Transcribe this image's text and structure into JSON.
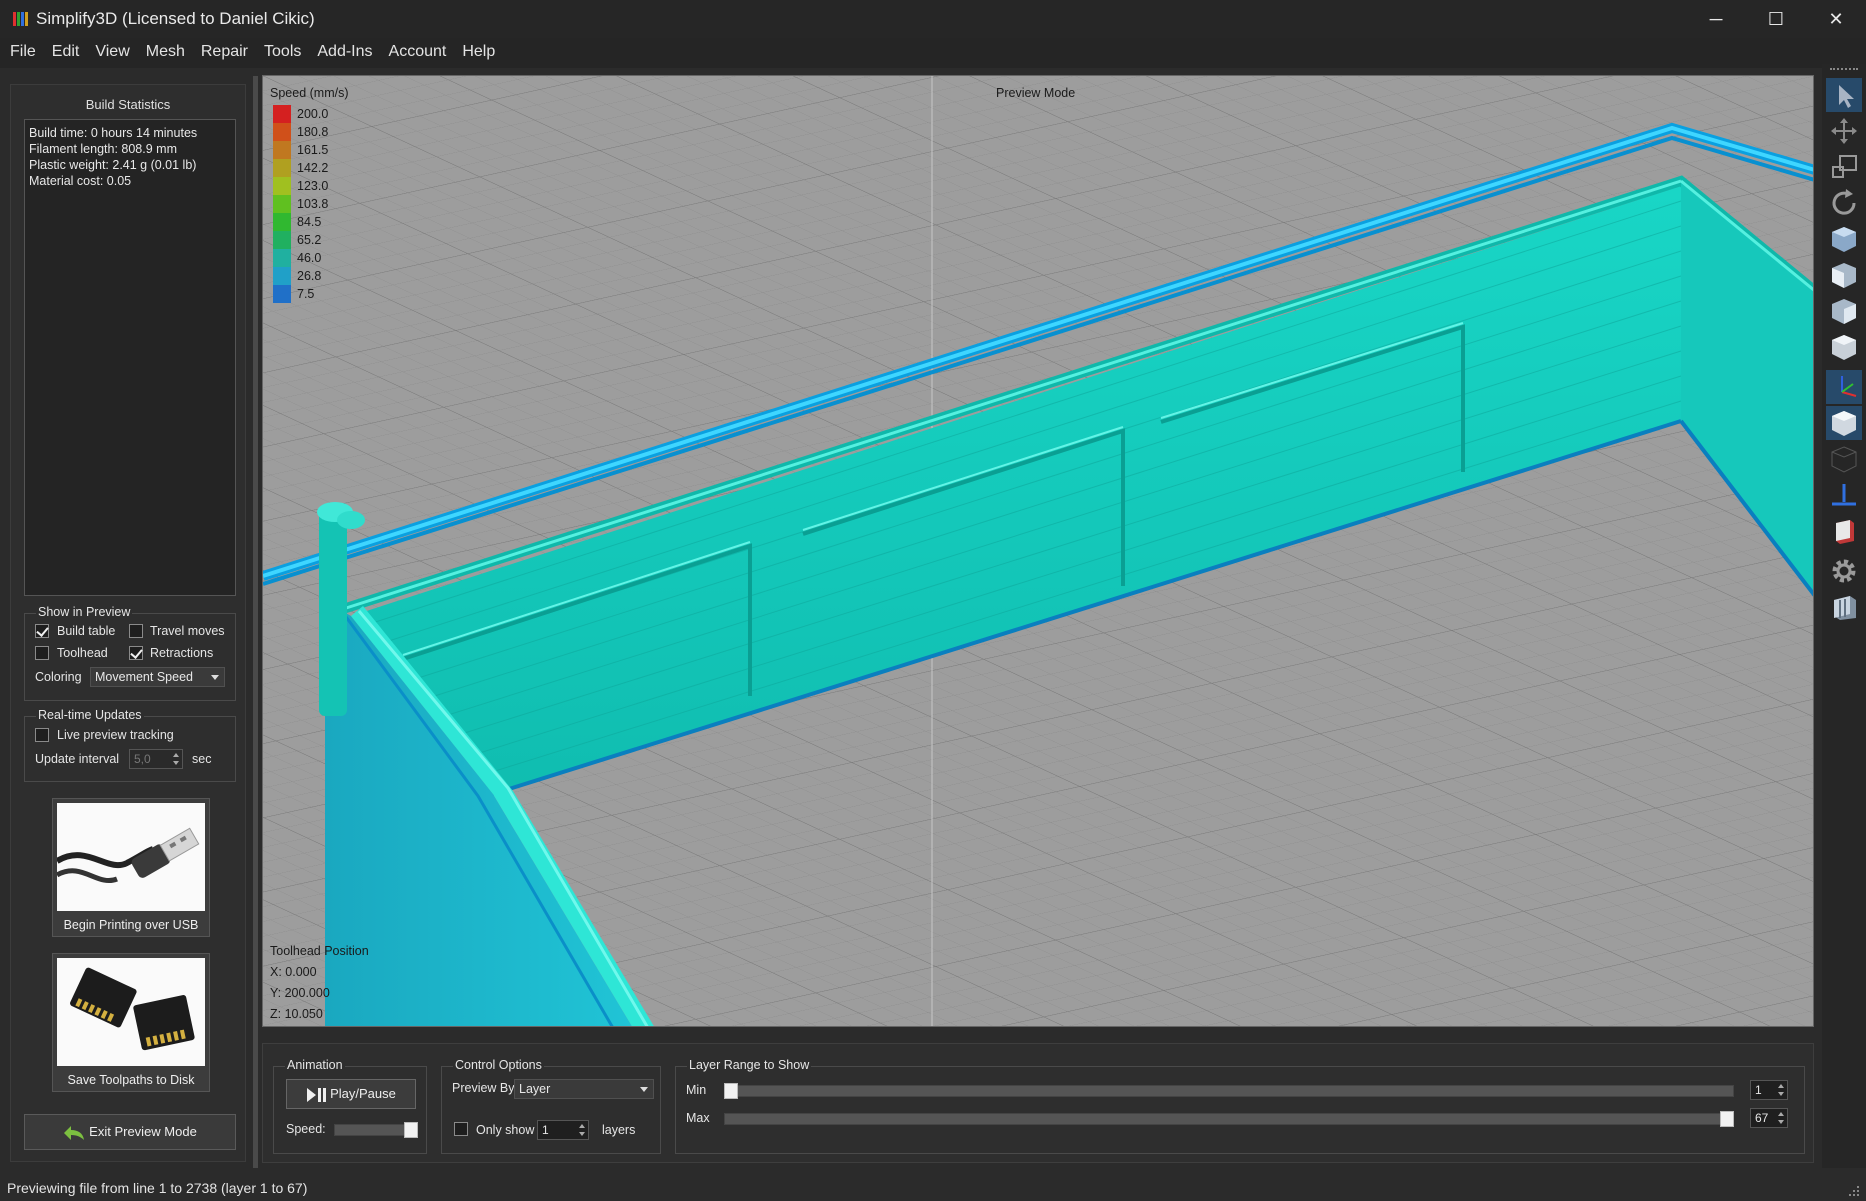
{
  "window": {
    "title": "Simplify3D (Licensed to Daniel Cikic)",
    "minimize": "─",
    "maximize": "☐",
    "close": "✕"
  },
  "menu": [
    "File",
    "Edit",
    "View",
    "Mesh",
    "Repair",
    "Tools",
    "Add-Ins",
    "Account",
    "Help"
  ],
  "left_panel": {
    "build_stats_title": "Build Statistics",
    "stats": [
      "Build time: 0 hours 14 minutes",
      "Filament length: 808.9 mm",
      "Plastic weight: 2.41 g (0.01 lb)",
      "Material cost: 0.05"
    ],
    "show_in_preview": {
      "title": "Show in Preview",
      "build_table": {
        "label": "Build table",
        "checked": true
      },
      "travel_moves": {
        "label": "Travel moves",
        "checked": false
      },
      "toolhead": {
        "label": "Toolhead",
        "checked": false
      },
      "retractions": {
        "label": "Retractions",
        "checked": true
      },
      "coloring_label": "Coloring",
      "coloring_value": "Movement Speed"
    },
    "realtime": {
      "title": "Real-time Updates",
      "live_preview": {
        "label": "Live preview tracking",
        "checked": false
      },
      "interval_label": "Update interval",
      "interval_value": "5,0",
      "interval_unit": "sec"
    },
    "usb_button_label": "Begin Printing over USB",
    "disk_button_label": "Save Toolpaths to Disk",
    "exit_button_label": "Exit Preview Mode"
  },
  "viewport": {
    "mode_label": "Preview Mode",
    "legend_title": "Speed (mm/s)",
    "legend": [
      {
        "value": "200.0",
        "color": "#d42020"
      },
      {
        "value": "180.8",
        "color": "#d0501a"
      },
      {
        "value": "161.5",
        "color": "#c07820"
      },
      {
        "value": "142.2",
        "color": "#b0a020"
      },
      {
        "value": "123.0",
        "color": "#a0c020"
      },
      {
        "value": "103.8",
        "color": "#60c020"
      },
      {
        "value": "84.5",
        "color": "#30b830"
      },
      {
        "value": "65.2",
        "color": "#20b060"
      },
      {
        "value": "46.0",
        "color": "#20b0a0"
      },
      {
        "value": "26.8",
        "color": "#20a0c8"
      },
      {
        "value": "7.5",
        "color": "#2070c8"
      }
    ],
    "toolhead": {
      "title": "Toolhead Position",
      "x": "X: 0.000",
      "y": "Y: 200.000",
      "z": "Z: 10.050"
    }
  },
  "bottom_panel": {
    "animation": {
      "title": "Animation",
      "play_label": "Play/Pause",
      "speed_label": "Speed:",
      "speed_fraction": 1.0
    },
    "control": {
      "title": "Control Options",
      "preview_by_label": "Preview By",
      "preview_by_value": "Layer",
      "only_show_label": "Only show",
      "only_show_value": "1",
      "layers_label": "layers",
      "only_show_checked": false
    },
    "layer_range": {
      "title": "Layer Range to Show",
      "min_label": "Min",
      "max_label": "Max",
      "min_value": "1",
      "max_value": "67",
      "total_layers": 67
    }
  },
  "status": {
    "text": "Previewing file from line 1 to 2738 (layer 1 to 67)"
  },
  "toolbar_icons": [
    "select-icon",
    "move-icon",
    "scale-icon",
    "rotate-icon",
    "view-top-icon",
    "view-front-icon",
    "view-left-icon",
    "view-iso-icon",
    "axes-icon",
    "solid-view-icon",
    "wireframe-view-icon",
    "cross-section-icon",
    "print-settings-icon",
    "settings-icon",
    "machine-icon"
  ]
}
